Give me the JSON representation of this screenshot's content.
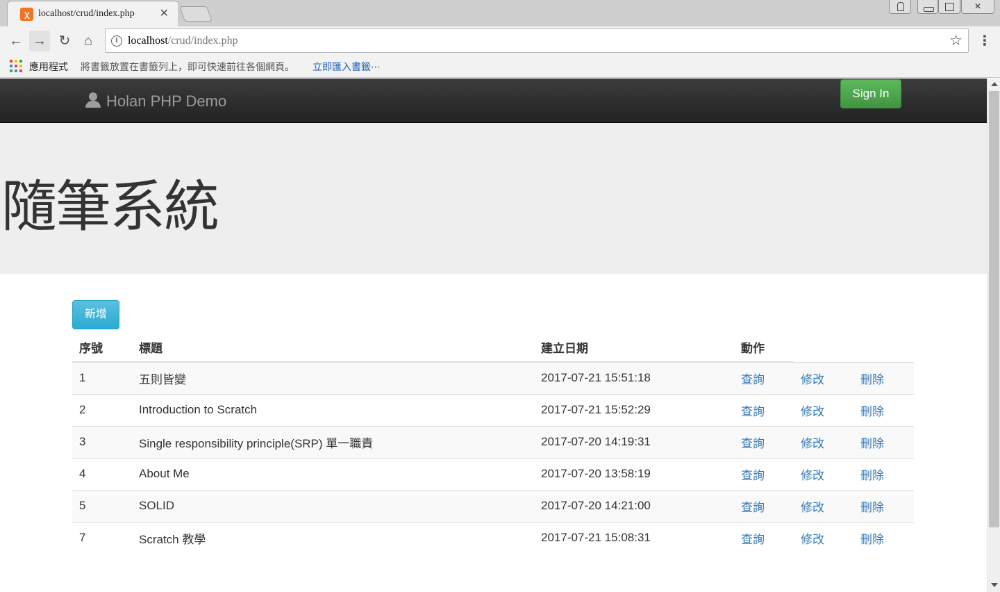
{
  "browser": {
    "tab": {
      "title": "localhost/crud/index.php",
      "favicon": "xampp-icon",
      "close": "✕"
    },
    "window_buttons": [
      "profile-icon",
      "minimize-icon",
      "restore-icon",
      "close-icon"
    ],
    "window_close_glyph": "✕",
    "nav": {
      "back": "←",
      "forward": "→",
      "reload": "↻",
      "home": "⌂"
    },
    "address": {
      "host": "localhost",
      "path": "/crud/index.php",
      "info": "i",
      "star": "☆"
    },
    "menu": "⋮",
    "bookmarks_bar": {
      "apps_label": "應用程式",
      "hint": "將書籤放置在書籤列上，即可快速前往各個網頁。",
      "import_link": "立即匯入書籤⋯"
    },
    "apps_colors": [
      "#ea4335",
      "#fbbc05",
      "#34a853",
      "#4285f4",
      "#ea4335",
      "#fbbc05",
      "#34a853",
      "#4285f4",
      "#ea4335"
    ]
  },
  "page": {
    "navbar": {
      "brand": "Holan PHP Demo",
      "signin": "Sign In"
    },
    "jumbotron": {
      "title": "隨筆系統"
    },
    "add_button": "新增",
    "table": {
      "headers": {
        "no": "序號",
        "title": "標題",
        "date": "建立日期",
        "actions": "動作"
      },
      "actions": {
        "view": "查詢",
        "edit": "修改",
        "delete": "刪除"
      },
      "rows": [
        {
          "no": "1",
          "title": "五則皆變",
          "date": "2017-07-21 15:51:18"
        },
        {
          "no": "2",
          "title": "Introduction to Scratch",
          "date": "2017-07-21 15:52:29"
        },
        {
          "no": "3",
          "title": "Single responsibility principle(SRP) 單一職責",
          "date": "2017-07-20 14:19:31"
        },
        {
          "no": "4",
          "title": "About Me",
          "date": "2017-07-20 13:58:19"
        },
        {
          "no": "5",
          "title": "SOLID",
          "date": "2017-07-20 14:21:00"
        },
        {
          "no": "7",
          "title": "Scratch 教學",
          "date": "2017-07-21 15:08:31"
        }
      ]
    },
    "colors": {
      "navbar": "#222222",
      "signin": "#5cb85c",
      "add": "#5bc0de",
      "link": "#337ab7",
      "jumbotron": "#eeeeee"
    }
  }
}
